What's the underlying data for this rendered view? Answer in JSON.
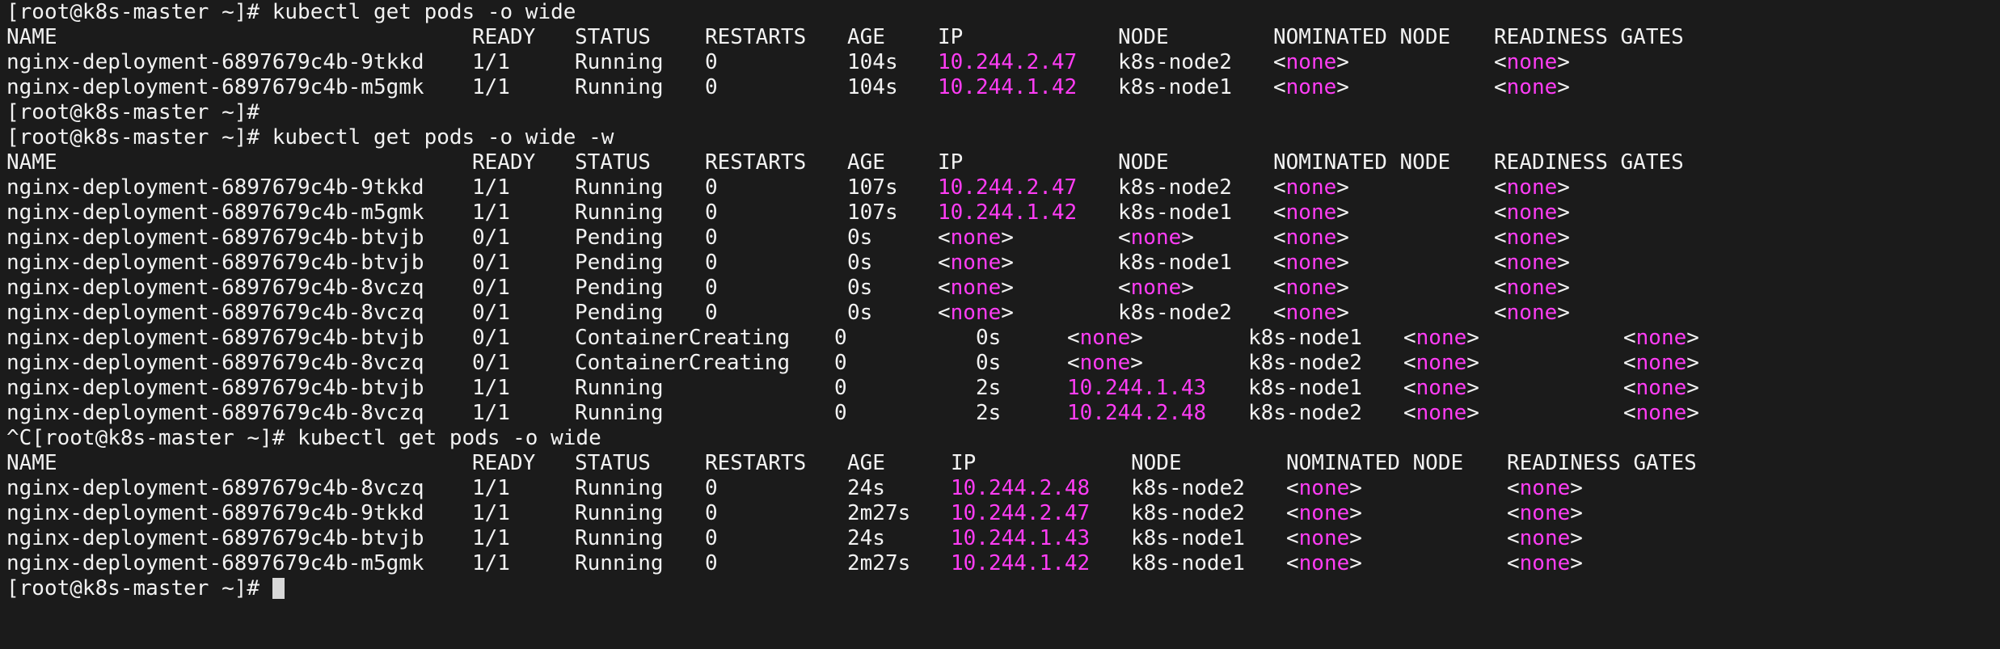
{
  "prompt": "[root@k8s-master ~]# ",
  "commands": {
    "c1": "kubectl get pods -o wide",
    "c2": "kubectl get pods -o wide -w",
    "c3": "kubectl get pods -o wide"
  },
  "interrupt": "^C",
  "headers": [
    "NAME",
    "READY",
    "STATUS",
    "RESTARTS",
    "AGE",
    "IP",
    "NODE",
    "NOMINATED NODE",
    "READINESS GATES"
  ],
  "none_open": "<",
  "none_word": "none",
  "none_close": ">",
  "block1": [
    [
      "nginx-deployment-6897679c4b-9tkkd",
      "1/1",
      "Running",
      "0",
      "104s",
      "10.244.2.47",
      "k8s-node2"
    ],
    [
      "nginx-deployment-6897679c4b-m5gmk",
      "1/1",
      "Running",
      "0",
      "104s",
      "10.244.1.42",
      "k8s-node1"
    ]
  ],
  "block2a": [
    [
      "nginx-deployment-6897679c4b-9tkkd",
      "1/1",
      "Running",
      "0",
      "107s",
      "10.244.2.47",
      "k8s-node2"
    ],
    [
      "nginx-deployment-6897679c4b-m5gmk",
      "1/1",
      "Running",
      "0",
      "107s",
      "10.244.1.42",
      "k8s-node1"
    ],
    [
      "nginx-deployment-6897679c4b-btvjb",
      "0/1",
      "Pending",
      "0",
      "0s",
      "",
      ""
    ],
    [
      "nginx-deployment-6897679c4b-btvjb",
      "0/1",
      "Pending",
      "0",
      "0s",
      "",
      "k8s-node1"
    ],
    [
      "nginx-deployment-6897679c4b-8vczq",
      "0/1",
      "Pending",
      "0",
      "0s",
      "",
      ""
    ],
    [
      "nginx-deployment-6897679c4b-8vczq",
      "0/1",
      "Pending",
      "0",
      "0s",
      "",
      "k8s-node2"
    ]
  ],
  "block2b": [
    [
      "nginx-deployment-6897679c4b-btvjb",
      "0/1",
      "ContainerCreating",
      "0",
      "0s",
      "",
      "k8s-node1"
    ],
    [
      "nginx-deployment-6897679c4b-8vczq",
      "0/1",
      "ContainerCreating",
      "0",
      "0s",
      "",
      "k8s-node2"
    ],
    [
      "nginx-deployment-6897679c4b-btvjb",
      "1/1",
      "Running",
      "0",
      "2s",
      "10.244.1.43",
      "k8s-node1"
    ],
    [
      "nginx-deployment-6897679c4b-8vczq",
      "1/1",
      "Running",
      "0",
      "2s",
      "10.244.2.48",
      "k8s-node2"
    ]
  ],
  "block3": [
    [
      "nginx-deployment-6897679c4b-8vczq",
      "1/1",
      "Running",
      "0",
      "24s",
      "10.244.2.48",
      "k8s-node2"
    ],
    [
      "nginx-deployment-6897679c4b-9tkkd",
      "1/1",
      "Running",
      "0",
      "2m27s",
      "10.244.2.47",
      "k8s-node2"
    ],
    [
      "nginx-deployment-6897679c4b-btvjb",
      "1/1",
      "Running",
      "0",
      "24s",
      "10.244.1.43",
      "k8s-node1"
    ],
    [
      "nginx-deployment-6897679c4b-m5gmk",
      "1/1",
      "Running",
      "0",
      "2m27s",
      "10.244.1.42",
      "k8s-node1"
    ]
  ],
  "colors": {
    "background": "#1b1b1b",
    "foreground": "#f2f2f2",
    "highlight": "#ff3df5",
    "cursor": "#d8d8d8"
  }
}
